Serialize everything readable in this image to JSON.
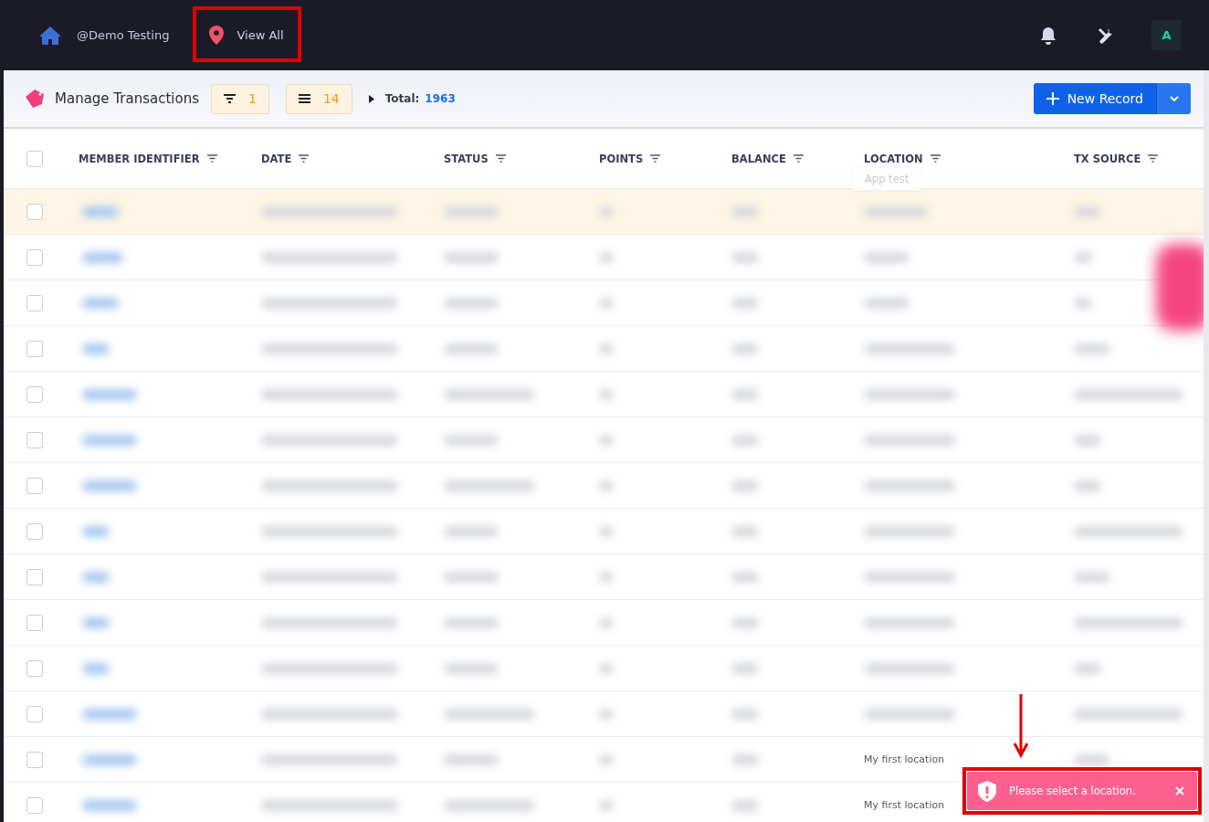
{
  "topbar": {
    "account": "@Demo Testing",
    "location": "View All",
    "avatar": "A"
  },
  "toolbar": {
    "title": "Manage Transactions",
    "filter_count": "1",
    "column_count": "14",
    "total_label": "Total:",
    "total": "1963",
    "new_button": "New Record"
  },
  "table": {
    "header_checked": false,
    "tooltip": "App test",
    "columns": [
      "MEMBER IDENTIFIER",
      "DATE",
      "STATUS",
      "POINTS",
      "BALANCE",
      "LOCATION",
      "TX SOURCE"
    ],
    "rows": [
      {
        "selected": true,
        "checked": false
      },
      {
        "selected": false,
        "checked": false
      },
      {
        "selected": false,
        "checked": false
      },
      {
        "selected": false,
        "checked": false
      },
      {
        "selected": false,
        "checked": false
      },
      {
        "selected": false,
        "checked": false
      },
      {
        "selected": false,
        "checked": false
      },
      {
        "selected": false,
        "checked": false
      },
      {
        "selected": false,
        "checked": false
      },
      {
        "selected": false,
        "checked": false
      },
      {
        "selected": false,
        "checked": false
      },
      {
        "selected": false,
        "checked": false
      },
      {
        "selected": false,
        "checked": false,
        "location": "My first location"
      },
      {
        "selected": false,
        "checked": false,
        "location": "My first location"
      }
    ]
  },
  "toast": {
    "message": "Please select a location."
  }
}
